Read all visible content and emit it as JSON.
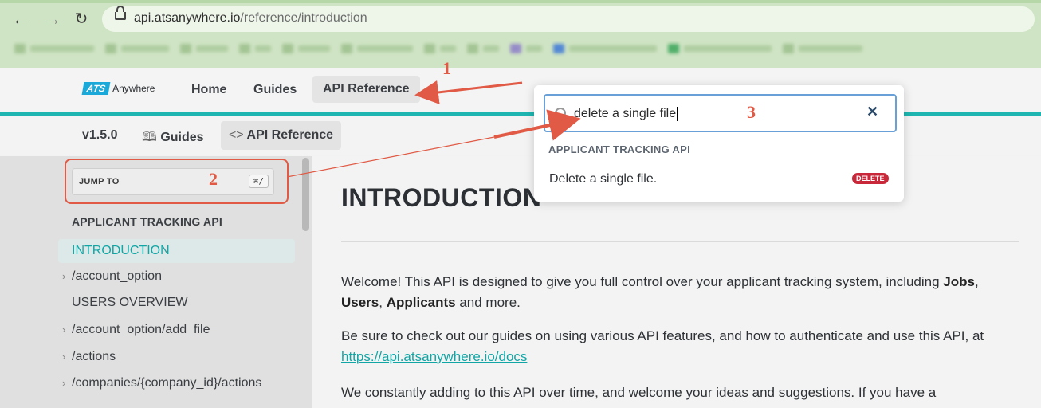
{
  "browser": {
    "back_icon": "arrow-left-icon",
    "forward_icon": "arrow-right-icon",
    "reload_icon": "reload-icon",
    "url_host": "api.atsanywhere.io",
    "url_path": "/reference/introduction"
  },
  "site": {
    "logo_brand": "ATS",
    "logo_suffix": "Anywhere",
    "nav": {
      "home": "Home",
      "guides": "Guides",
      "api_reference": "API Reference"
    }
  },
  "subnav": {
    "version": "v1.5.0",
    "guides": "Guides",
    "api_reference": "API Reference"
  },
  "sidebar": {
    "jump_to": "JUMP TO",
    "jump_shortcut": "⌘/",
    "section": "APPLICANT TRACKING API",
    "items": [
      {
        "label": "INTRODUCTION"
      },
      {
        "label": "/account_option"
      },
      {
        "label": "USERS OVERVIEW"
      },
      {
        "label": "/account_option/add_file"
      },
      {
        "label": "/actions"
      },
      {
        "label": "/companies/{company_id}/actions"
      }
    ]
  },
  "main": {
    "title": "INTRODUCTION",
    "p1_a": "Welcome! This API is designed to give you full control over your applicant tracking system, including ",
    "p1_b1": "Jobs",
    "p1_c": ",",
    "p1_b2": "Users",
    "p1_d": ", ",
    "p1_b3": "Applicants",
    "p1_e": " and more.",
    "p2": "Be sure to check out our guides on using various API features, and how to authenticate and use this API, at",
    "p2_link": "https://api.atsanywhere.io/docs",
    "p3": "We constantly adding to this API over time, and welcome your ideas and suggestions. If you have a"
  },
  "search": {
    "query": "delete a single file",
    "category": "APPLICANT TRACKING API",
    "result": "Delete a single file.",
    "badge": "DELETE"
  },
  "annotations": {
    "n1": "1",
    "n2": "2",
    "n3": "3",
    "color": "#e05a45"
  }
}
